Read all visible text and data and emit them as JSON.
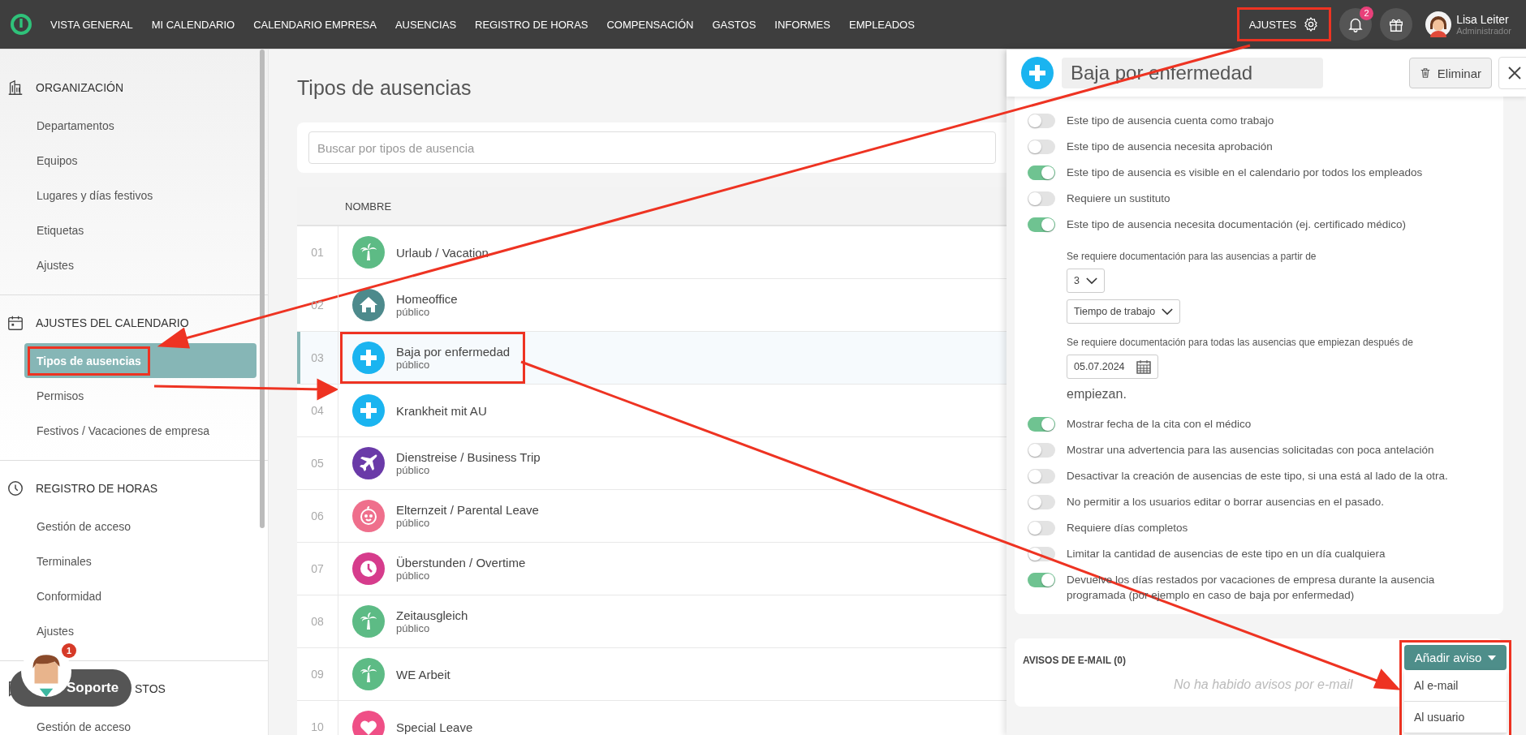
{
  "nav": {
    "items": [
      "VISTA GENERAL",
      "MI CALENDARIO",
      "CALENDARIO EMPRESA",
      "AUSENCIAS",
      "REGISTRO DE HORAS",
      "COMPENSACIÓN",
      "GASTOS",
      "INFORMES",
      "EMPLEADOS"
    ],
    "settings": {
      "label": "AJUSTES",
      "highlighted": true
    },
    "notifications": "2",
    "user": {
      "name": "Lisa Leiter",
      "role": "Administrador"
    }
  },
  "sidebar": [
    {
      "title": "ORGANIZACIÓN",
      "kind": "building",
      "items": [
        {
          "label": "Departamentos",
          "selected": false
        },
        {
          "label": "Equipos",
          "selected": false
        },
        {
          "label": "Lugares y días festivos",
          "selected": false
        },
        {
          "label": "Etiquetas",
          "selected": false
        },
        {
          "label": "Ajustes",
          "selected": false
        }
      ]
    },
    {
      "title": "AJUSTES DEL CALENDARIO",
      "kind": "calendar",
      "items": [
        {
          "label": "Tipos de ausencias",
          "selected": true,
          "highlighted": true
        },
        {
          "label": "Permisos",
          "selected": false
        },
        {
          "label": "Festivos / Vacaciones de empresa",
          "selected": false
        }
      ]
    },
    {
      "title": "REGISTRO DE HORAS",
      "kind": "clock",
      "items": [
        {
          "label": "Gestión de acceso",
          "selected": false
        },
        {
          "label": "Terminales",
          "selected": false
        },
        {
          "label": "Conformidad",
          "selected": false
        },
        {
          "label": "Ajustes",
          "selected": false
        }
      ]
    },
    {
      "title": "STOS",
      "kind": "hidden",
      "items": [
        {
          "label": "Gestión de acceso",
          "selected": false
        }
      ]
    }
  ],
  "support": {
    "label": "Soporte",
    "badge": "1"
  },
  "page": {
    "title": "Tipos de ausencias",
    "search": {
      "placeholder": "Buscar por tipos de ausencia"
    },
    "column": "NOMBRE",
    "rows": [
      {
        "num": "01",
        "name": "Urlaub / Vacation",
        "kind": "palm",
        "color": "#5dbb85",
        "selected": false
      },
      {
        "num": "02",
        "name": "Homeoffice",
        "sub": "público",
        "kind": "house",
        "color": "#4d8a8c",
        "selected": false
      },
      {
        "num": "03",
        "name": "Baja por enfermedad",
        "sub": "público",
        "kind": "cross",
        "color": "#1ab4f0",
        "selected": true,
        "highlighted": true
      },
      {
        "num": "04",
        "name": "Krankheit mit AU",
        "kind": "cross",
        "color": "#1ab4f0",
        "selected": false
      },
      {
        "num": "05",
        "name": "Dienstreise / Business Trip",
        "sub": "público",
        "kind": "plane",
        "color": "#6a3aa8",
        "selected": false
      },
      {
        "num": "06",
        "name": "Elternzeit / Parental Leave",
        "sub": "público",
        "kind": "baby",
        "color": "#ef6f8c",
        "selected": false
      },
      {
        "num": "07",
        "name": "Überstunden / Overtime",
        "sub": "público",
        "kind": "clock",
        "color": "#d63c8c",
        "selected": false
      },
      {
        "num": "08",
        "name": "Zeitausgleich",
        "sub": "público",
        "kind": "palm",
        "color": "#5dbb85",
        "selected": false
      },
      {
        "num": "09",
        "name": "WE Arbeit",
        "kind": "palm",
        "color": "#5dbb85",
        "selected": false
      },
      {
        "num": "10",
        "name": "Special Leave",
        "kind": "heart",
        "color": "#ef4f86",
        "selected": false
      }
    ]
  },
  "panel": {
    "title": "Baja por enfermedad",
    "delete": "Eliminar",
    "settings": [
      {
        "kind": "toggle",
        "label": "Este tipo de ausencia cuenta como trabajo",
        "on": false
      },
      {
        "kind": "toggle",
        "label": "Este tipo de ausencia necesita aprobación",
        "on": false
      },
      {
        "kind": "toggle",
        "label": "Este tipo de ausencia es visible en el calendario por todos los empleados",
        "on": true
      },
      {
        "kind": "toggle",
        "label": "Requiere un sustituto",
        "on": false
      },
      {
        "kind": "toggle",
        "label": "Este tipo de ausencia necesita documentación (ej. certificado médico)",
        "on": true
      },
      {
        "kind": "caption",
        "label": "Se requiere documentación para las ausencias a partir de"
      },
      {
        "kind": "select",
        "label": "3"
      },
      {
        "kind": "select",
        "label": "Tiempo de trabajo"
      },
      {
        "kind": "caption",
        "label": "Se requiere documentación para todas las ausencias que empiezan después de"
      },
      {
        "kind": "date",
        "label": "05.07.2024"
      },
      {
        "kind": "note",
        "label": "empiezan."
      },
      {
        "kind": "toggle",
        "label": "Mostrar fecha de la cita con el médico",
        "on": true
      },
      {
        "kind": "toggle",
        "label": "Mostrar una advertencia para las ausencias solicitadas con poca antelación",
        "on": false
      },
      {
        "kind": "toggle",
        "label": "Desactivar la creación de ausencias de este tipo, si una está al lado de la otra.",
        "on": false
      },
      {
        "kind": "toggle",
        "label": "No permitir a los usuarios editar o borrar ausencias en el pasado.",
        "on": false
      },
      {
        "kind": "toggle",
        "label": "Requiere días completos",
        "on": false
      },
      {
        "kind": "toggle",
        "label": "Limitar la cantidad de ausencias de este tipo en un día cualquiera",
        "on": false
      },
      {
        "kind": "toggle",
        "label": "Devuelve los días restados por vacaciones de empresa durante la ausencia programada (por ejemplo en caso de baja por enfermedad)",
        "on": true
      }
    ],
    "emails": {
      "title": "AVISOS DE E-MAIL (0)",
      "empty": "No ha habido avisos por e-mail",
      "add": "Añadir aviso",
      "highlighted": true,
      "menu": [
        "Al e-mail",
        "Al usuario"
      ]
    }
  }
}
